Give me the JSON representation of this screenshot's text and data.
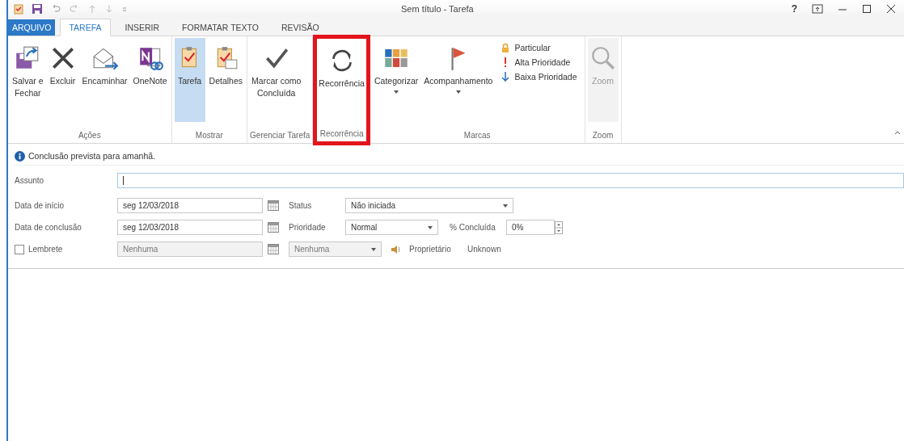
{
  "window": {
    "title": "Sem título - Tarefa",
    "help": "?"
  },
  "tabs": [
    {
      "label": "ARQUIVO",
      "kind": "file",
      "selected": false
    },
    {
      "label": "TAREFA",
      "kind": "tab",
      "selected": true
    },
    {
      "label": "INSERIR",
      "kind": "tab",
      "selected": false
    },
    {
      "label": "FORMATAR TEXTO",
      "kind": "tab",
      "selected": false
    },
    {
      "label": "REVISÃO",
      "kind": "tab",
      "selected": false
    }
  ],
  "groups": [
    {
      "label": "Ações",
      "highlighted": false,
      "buttons": [
        {
          "label": "Salvar e\nFechar",
          "selected": false,
          "has_menu": false,
          "disabled": false
        },
        {
          "label": "Excluir",
          "selected": false,
          "has_menu": false,
          "disabled": false
        },
        {
          "label": "Encaminhar",
          "selected": false,
          "has_menu": false,
          "disabled": false
        },
        {
          "label": "OneNote",
          "selected": false,
          "has_menu": false,
          "disabled": false
        }
      ]
    },
    {
      "label": "Mostrar",
      "highlighted": false,
      "buttons": [
        {
          "label": "Tarefa",
          "selected": true,
          "has_menu": false,
          "disabled": false
        },
        {
          "label": "Detalhes",
          "selected": false,
          "has_menu": false,
          "disabled": false
        }
      ]
    },
    {
      "label": "Gerenciar Tarefa",
      "highlighted": false,
      "buttons": [
        {
          "label": "Marcar como\nConcluída",
          "selected": false,
          "has_menu": false,
          "disabled": false
        }
      ]
    },
    {
      "label": "Recorrência",
      "highlighted": true,
      "buttons": [
        {
          "label": "Recorrência",
          "selected": false,
          "has_menu": false,
          "disabled": false
        }
      ]
    },
    {
      "label": "Marcas",
      "highlighted": false,
      "buttons": [
        {
          "label": "Categorizar",
          "selected": false,
          "has_menu": true,
          "disabled": false
        },
        {
          "label": "Acompanhamento",
          "selected": false,
          "has_menu": true,
          "disabled": false
        }
      ],
      "small_buttons": [
        {
          "label": "Particular"
        },
        {
          "label": "Alta Prioridade"
        },
        {
          "label": "Baixa Prioridade"
        }
      ]
    },
    {
      "label": "Zoom",
      "highlighted": false,
      "buttons": [
        {
          "label": "Zoom",
          "selected": false,
          "has_menu": false,
          "disabled": true
        }
      ]
    }
  ],
  "info": "Conclusão prevista para amanhã.",
  "subject": {
    "label": "Assunto"
  },
  "start": {
    "label": "Data de início",
    "value": "seg 12/03/2018"
  },
  "status": {
    "label": "Status",
    "value": "Não iniciada"
  },
  "due": {
    "label": "Data de conclusão",
    "value": "seg 12/03/2018"
  },
  "priority": {
    "label": "Prioridade",
    "value": "Normal"
  },
  "percent": {
    "label": "% Concluída",
    "value": "0%"
  },
  "reminder": {
    "label": "Lembrete",
    "checked": false,
    "date": "Nenhuma",
    "time": "Nenhuma"
  },
  "owner": {
    "label": "Proprietário",
    "value": "Unknown"
  }
}
